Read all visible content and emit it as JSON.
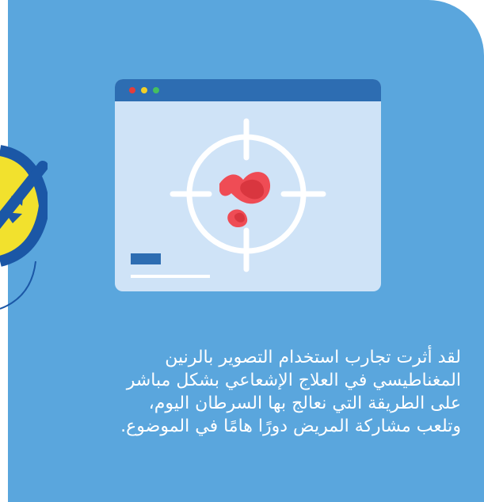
{
  "card": {
    "background": "#5aa6dd",
    "accent": "#2d6db2"
  },
  "illustration": {
    "window_controls": [
      "red-dot",
      "yellow-dot",
      "green-dot"
    ],
    "target_icon": "crosshair-target-icon",
    "highlight_icon": "red-spot-icon"
  },
  "body": {
    "lines": [
      "لقد أثرت تجارب استخدام التصوير بالرنين",
      "المغناطيسي في العلاج الإشعاعي بشكل مباشر",
      "على الطريقة التي نعالج بها السرطان اليوم،",
      "وتلعب مشاركة المريض دورًا هامًا في الموضوع."
    ]
  },
  "colors": {
    "white": "#ffffff",
    "red": "#e43d3a",
    "yellow": "#f2d027",
    "green": "#45bf5f",
    "spot": "#ef4c55",
    "spot_dark": "#d9363f",
    "yellow_badge": "#f2e12d",
    "dark_blue": "#1b57a6"
  }
}
